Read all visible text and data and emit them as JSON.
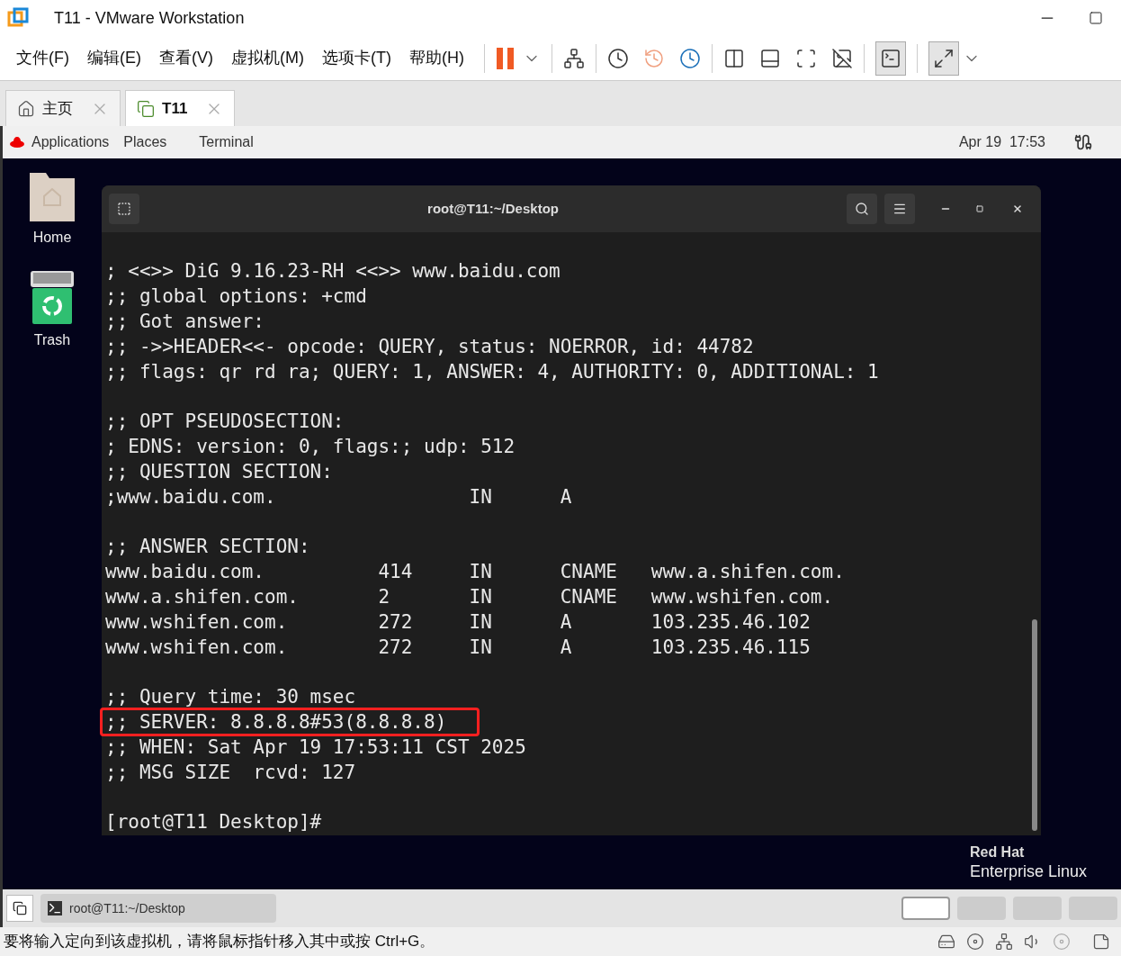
{
  "window": {
    "title": "T11 - VMware Workstation"
  },
  "menu": [
    "文件(F)",
    "编辑(E)",
    "查看(V)",
    "虚拟机(M)",
    "选项卡(T)",
    "帮助(H)"
  ],
  "tabs": [
    {
      "label": "主页",
      "selected": false
    },
    {
      "label": "T11",
      "selected": true
    }
  ],
  "guest": {
    "top_bar": {
      "applications": "Applications",
      "places": "Places",
      "app": "Terminal",
      "date": "Apr 19",
      "time": "17:53"
    },
    "desktop_icons": [
      {
        "kind": "folder",
        "label": "Home"
      },
      {
        "kind": "trash",
        "label": "Trash"
      }
    ],
    "terminal": {
      "title": "root@T11:~/Desktop",
      "blocks": [
        [
          {
            "text": "; <<>> DiG 9.16.23-RH <<>> www.baidu.com",
            "highlighted": false
          },
          {
            "text": ";; global options: +cmd",
            "highlighted": false
          },
          {
            "text": ";; Got answer:",
            "highlighted": false
          },
          {
            "text": ";; ->>HEADER<<- opcode: QUERY, status: NOERROR, id: 44782",
            "highlighted": false
          },
          {
            "text": ";; flags: qr rd ra; QUERY: 1, ANSWER: 4, AUTHORITY: 0, ADDITIONAL: 1",
            "highlighted": false
          }
        ],
        [
          {
            "text": ";; OPT PSEUDOSECTION:",
            "highlighted": false
          },
          {
            "text": "; EDNS: version: 0, flags:; udp: 512",
            "highlighted": false
          },
          {
            "text": ";; QUESTION SECTION:",
            "highlighted": false
          },
          {
            "text": ";www.baidu.com.                 IN      A",
            "highlighted": false
          }
        ],
        [
          {
            "text": ";; ANSWER SECTION:",
            "highlighted": false
          },
          {
            "text": "www.baidu.com.          414     IN      CNAME   www.a.shifen.com.",
            "highlighted": false
          },
          {
            "text": "www.a.shifen.com.       2       IN      CNAME   www.wshifen.com.",
            "highlighted": false
          },
          {
            "text": "www.wshifen.com.        272     IN      A       103.235.46.102",
            "highlighted": false
          },
          {
            "text": "www.wshifen.com.        272     IN      A       103.235.46.115",
            "highlighted": false
          }
        ],
        [
          {
            "text": ";; Query time: 30 msec",
            "highlighted": false
          },
          {
            "text": ";; SERVER: 8.8.8.8#53(8.8.8.8)",
            "highlighted": true
          },
          {
            "text": ";; WHEN: Sat Apr 19 17:53:11 CST 2025",
            "highlighted": false
          },
          {
            "text": ";; MSG SIZE  rcvd: 127",
            "highlighted": false
          }
        ],
        [
          {
            "text": "[root@T11 Desktop]#",
            "highlighted": false
          }
        ]
      ]
    },
    "brand": {
      "line_1": "Red Hat",
      "line_2": "Enterprise Linux"
    },
    "taskbar": {
      "window": "root@T11:~/Desktop",
      "workspaces": [
        {
          "selected": true
        },
        {
          "selected": false
        },
        {
          "selected": false
        },
        {
          "selected": false
        }
      ]
    }
  },
  "status_bar": {
    "message": "要将输入定向到该虚拟机，请将鼠标指针移入其中或按 Ctrl+G。"
  }
}
